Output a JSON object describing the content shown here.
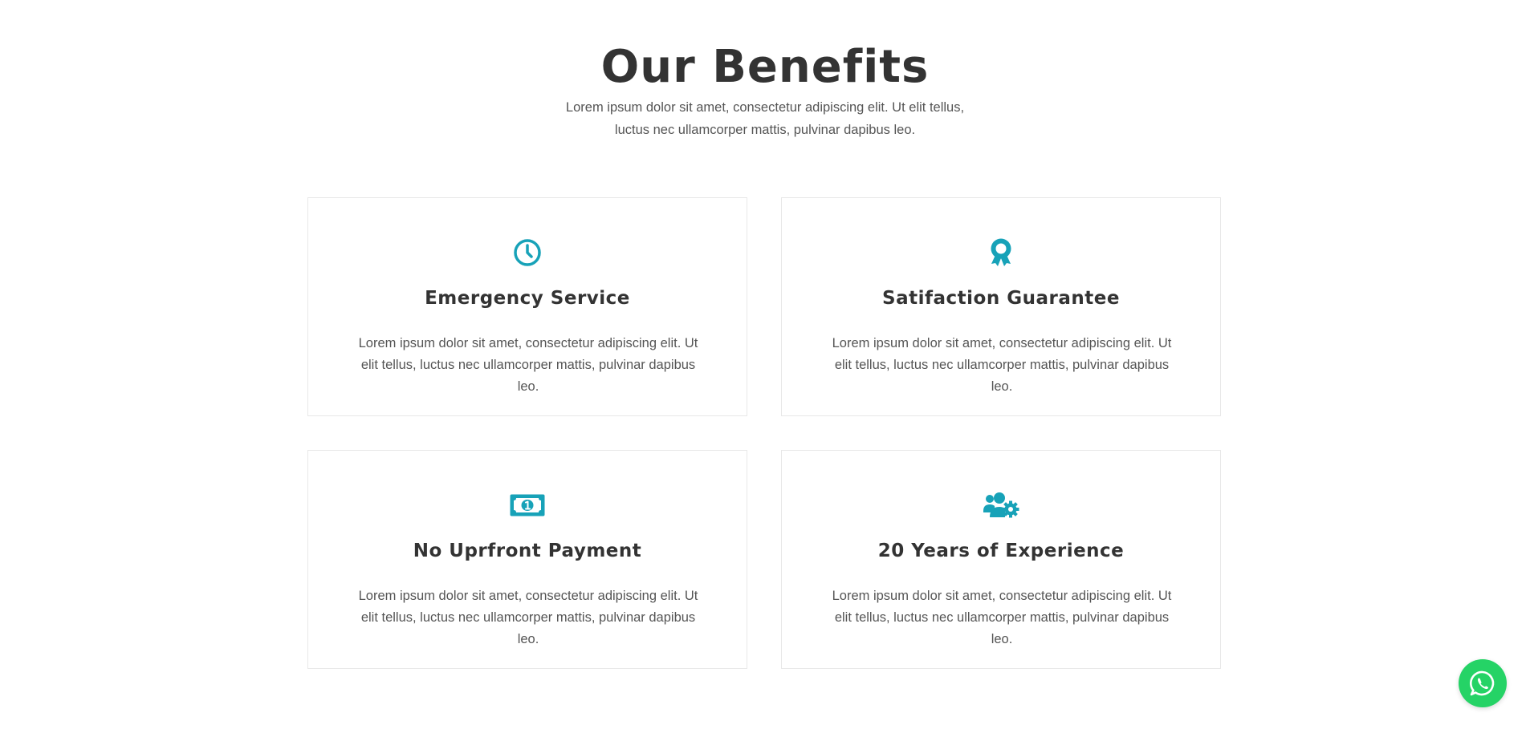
{
  "header": {
    "title": "Our Benefits",
    "subtitle": "Lorem ipsum dolor sit amet, consectetur adipiscing elit. Ut elit tellus, luctus nec ullamcorper mattis, pulvinar dapibus leo."
  },
  "accent_color": "#17a2b8",
  "benefits": [
    {
      "icon": "clock-icon",
      "title": "Emergency Service",
      "text": "Lorem ipsum dolor sit amet, consectetur adipiscing elit. Ut elit tellus, luctus nec ullamcorper mattis, pulvinar dapibus leo."
    },
    {
      "icon": "award-icon",
      "title": "Satifaction Guarantee",
      "text": "Lorem ipsum dolor sit amet, consectetur adipiscing elit. Ut elit tellus, luctus nec ullamcorper mattis, pulvinar dapibus leo."
    },
    {
      "icon": "money-bill-icon",
      "title": "No Uprfront Payment",
      "text": "Lorem ipsum dolor sit amet, consectetur adipiscing elit. Ut elit tellus, luctus nec ullamcorper mattis, pulvinar dapibus leo."
    },
    {
      "icon": "users-cog-icon",
      "title": "20 Years of Experience",
      "text": "Lorem ipsum dolor sit amet, consectetur adipiscing elit. Ut elit tellus, luctus nec ullamcorper mattis, pulvinar dapibus leo."
    }
  ],
  "whatsapp": {
    "icon": "whatsapp-icon",
    "color": "#25d366"
  }
}
